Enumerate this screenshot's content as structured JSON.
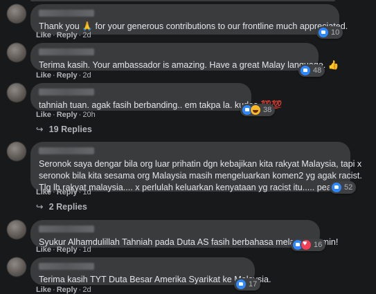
{
  "actions": {
    "like": "Like",
    "reply": "Reply",
    "separator": "·"
  },
  "comments": [
    {
      "text": "Thank you 🙏 for your generous contributions to our frontline much appreciated.",
      "time": "2d",
      "reaction_count": "10",
      "reactions": [
        "like"
      ]
    },
    {
      "text": "Terima kasih. Your ambassador is amazing. Have a great Malay language. 👍",
      "time": "2d",
      "reaction_count": "48",
      "reactions": [
        "like"
      ]
    },
    {
      "text": "tahniah tuan. agak fasih berbanding.. em takpa la. kudos 💯💯",
      "time": "20h",
      "reaction_count": "38",
      "reactions": [
        "like",
        "haha"
      ],
      "replies_label": "19 Replies"
    },
    {
      "text_lines": [
        "Seronok saya dengar bila org luar prihatin dgn kebajikan kita rakyat Malaysia, tapi x",
        "seronok bila kita sesama org Malaysia masih mengeluarkan komen2 yg agak racist.",
        "Tlg lh rakyat malaysia.... x perlulah keluarkan kenyataan yg racist itu..... peace"
      ],
      "time": "1d",
      "reaction_count": "52",
      "reactions": [
        "like"
      ],
      "replies_label": "2 Replies"
    },
    {
      "text": "Syukur Alhamdulillah Tahniah pada Duta AS fasih berbahasa melayu...Aamin!",
      "time": "1d",
      "reaction_count": "16",
      "reactions": [
        "like",
        "love"
      ]
    },
    {
      "text": "Terima kasih TYT Duta Besar Amerika Syarikat ke Malaysia.",
      "time": "2d",
      "reaction_count": "17",
      "reactions": [
        "like"
      ]
    }
  ],
  "icons": {
    "like": "like-reaction-icon",
    "haha": "haha-reaction-icon",
    "love": "love-reaction-icon",
    "reply_arrow": "reply-arrow-icon"
  },
  "colors": {
    "background": "#18191a",
    "bubble": "#3a3b3c",
    "text": "#e4e6eb",
    "secondary_text": "#b0b3b8",
    "like_blue": "#2d88ff",
    "love_red": "#f33e58",
    "haha_yellow": "#f7b928"
  }
}
